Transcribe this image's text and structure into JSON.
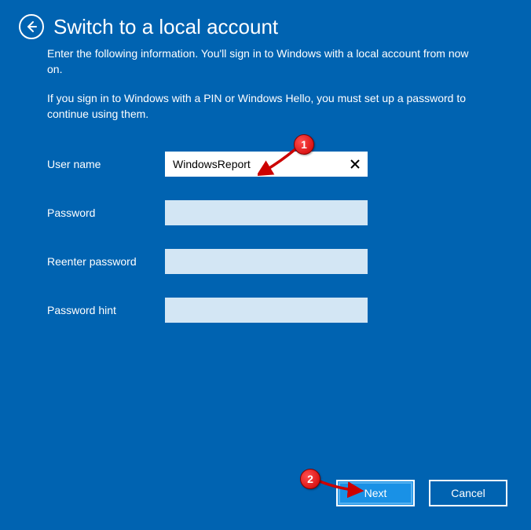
{
  "header": {
    "title": "Switch to a local account"
  },
  "content": {
    "subtitle": "Enter the following information. You'll sign in to Windows with a local account from now on.",
    "info": "If you sign in to Windows with a PIN or Windows Hello, you must set up a password to continue using them."
  },
  "form": {
    "username_label": "User name",
    "username_value": "WindowsReport",
    "password_label": "Password",
    "reenter_label": "Reenter password",
    "hint_label": "Password hint"
  },
  "footer": {
    "next_label": "Next",
    "cancel_label": "Cancel"
  },
  "annotations": {
    "marker1": "1",
    "marker2": "2"
  }
}
